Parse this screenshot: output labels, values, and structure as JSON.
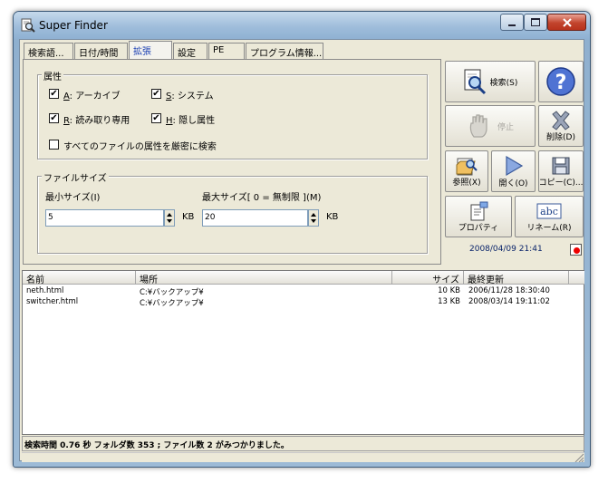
{
  "window": {
    "title": "Super Finder",
    "colors": {
      "title_bar": "#a9c4dc",
      "close_button": "#c2442c",
      "face": "#ece9d8"
    }
  },
  "tabs": [
    {
      "label": "検索語..."
    },
    {
      "label": "日付/時間"
    },
    {
      "label": "拡張",
      "active": true
    },
    {
      "label": "設定"
    },
    {
      "label": "PE"
    },
    {
      "label": "プログラム情報..."
    }
  ],
  "attributes": {
    "legend": "属性",
    "archive": {
      "key": "A",
      "label": ": アーカイブ",
      "checked": true,
      "mark": "✔"
    },
    "system": {
      "key": "S",
      "label": ": システム",
      "checked": true,
      "mark": "✔"
    },
    "readonly": {
      "key": "R",
      "label": ": 読み取り専用",
      "checked": true,
      "mark": "✔"
    },
    "hidden": {
      "key": "H",
      "label": ": 隠し属性",
      "checked": true,
      "mark": "✔"
    },
    "strict": {
      "label": "すべてのファイルの属性を厳密に検索",
      "checked": false,
      "mark": ""
    }
  },
  "filesize": {
    "legend": "ファイルサイズ",
    "min_label": "最小サイズ(I)",
    "min_value": "5",
    "min_unit": "KB",
    "max_label": "最大サイズ[ 0 = 無制限 ](M)",
    "max_value": "20",
    "max_unit": "KB"
  },
  "buttons": {
    "search": "検索(S)",
    "stop": "停止",
    "delete": "削除(D)",
    "browse": "参照(X)",
    "open": "開く(O)",
    "copy": "コピー(C)...",
    "properties": "プロパティ",
    "rename": "リネーム(R)",
    "help_icon": "question-icon"
  },
  "datetime": "2008/04/09 21:41",
  "table": {
    "columns": [
      "名前",
      "場所",
      "サイズ",
      "最終更新"
    ],
    "rows": [
      {
        "name": "neth.html",
        "location": "C:¥バックアップ¥",
        "size": "10 KB",
        "modified": "2006/11/28 18:30:40"
      },
      {
        "name": "switcher.html",
        "location": "C:¥バックアップ¥",
        "size": "13 KB",
        "modified": "2008/03/14 19:11:02"
      }
    ]
  },
  "status": "検索時間 0.76 秒 フォルダ数 353 ; ファイル数 2 がみつかりました。"
}
